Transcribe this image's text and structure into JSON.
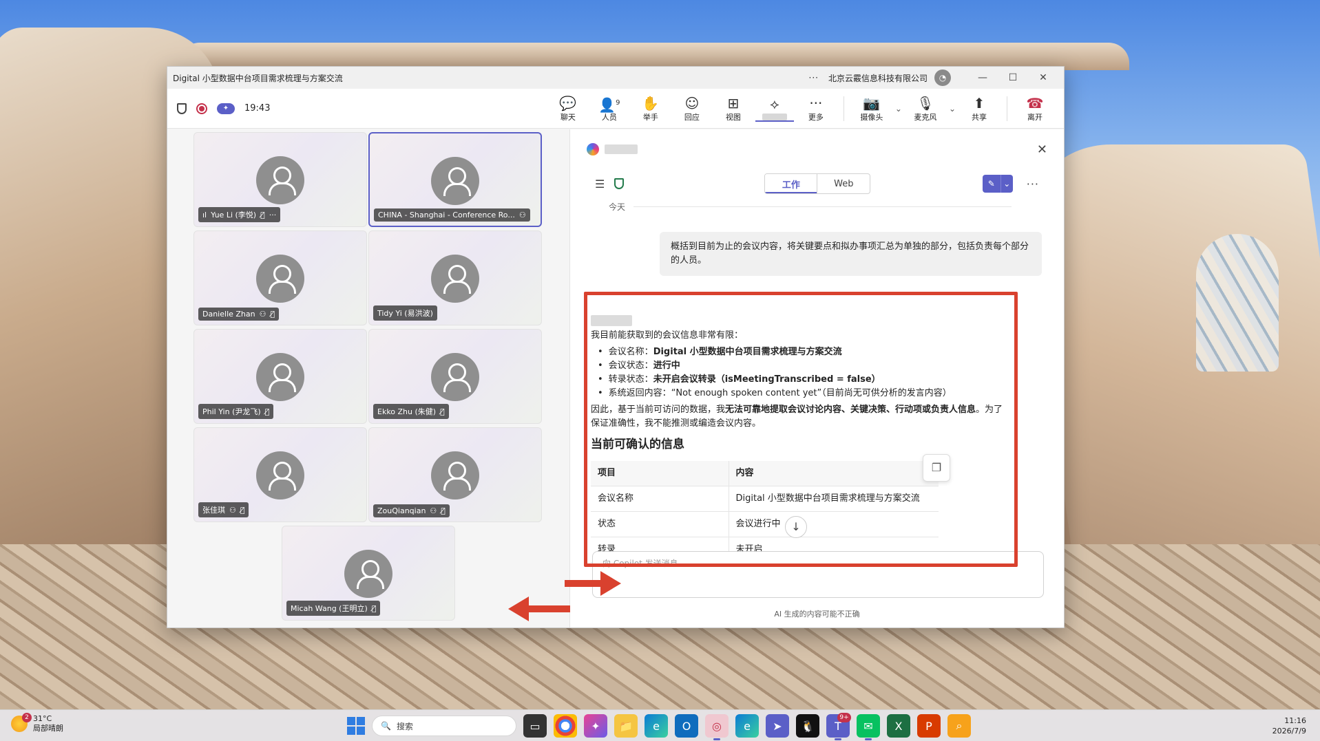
{
  "window": {
    "title": "Digital 小型数据中台项目需求梳理与方案交流",
    "more": "···",
    "org": "北京云霰信息科技有限公司",
    "controls": [
      "—",
      "☐",
      "✕"
    ]
  },
  "meeting": {
    "timer": "19:43",
    "ai_badge": "✦"
  },
  "toolbar": {
    "chat": "聊天",
    "people": "人员",
    "people_count": "9",
    "raise_hand": "举手",
    "react": "回应",
    "view": "视图",
    "more": "更多",
    "camera": "摄像头",
    "mic": "麦克风",
    "share": "共享",
    "leave": "离开"
  },
  "participants": [
    {
      "name": "Yue Li (李悦)",
      "extra": "···"
    },
    {
      "name": "CHINA - Shanghai - Conference Ro..."
    },
    {
      "name": "Danielle Zhan"
    },
    {
      "name": "Tidy Yi (易洪波)"
    },
    {
      "name": "Phil Yin (尹龙飞)"
    },
    {
      "name": "Ekko Zhu (朱健)"
    },
    {
      "name": "张佳琪"
    },
    {
      "name": "ZouQianqian"
    },
    {
      "name": "Micah Wang (王明立)"
    }
  ],
  "copilot": {
    "tabs": [
      "工作",
      "Web"
    ],
    "today": "今天",
    "user_prompt": "概括到目前为止的会议内容，将关键要点和拟办事项汇总为单独的部分，包括负责每个部分的人员。",
    "answer": {
      "intro": "我目前能获取到的会议信息非常有限：",
      "bullets": [
        {
          "label": "会议名称：",
          "value": "Digital 小型数据中台项目需求梳理与方案交流"
        },
        {
          "label": "会议状态：",
          "value": "进行中"
        },
        {
          "label": "转录状态：",
          "value": "未开启会议转录（isMeetingTranscribed = false）"
        },
        {
          "label": "系统返回内容：",
          "value": "“Not enough spoken content yet”（目前尚无可供分析的发言内容）"
        }
      ],
      "para_a": "因此，基于当前可访问的数据，我",
      "para_bold": "无法可靠地提取会议讨论内容、关键决策、行动项或负责人信息",
      "para_b": "。为了保证准确性，我不能推测或编造会议内容。",
      "heading": "当前可确认的信息",
      "table_headers": [
        "项目",
        "内容"
      ],
      "table_rows": [
        [
          "会议名称",
          "Digital 小型数据中台项目需求梳理与方案交流"
        ],
        [
          "状态",
          "会议进行中"
        ],
        [
          "转录",
          "未开启"
        ]
      ]
    },
    "compose_placeholder": "向 Copilot 发送消息",
    "disclaimer": "AI 生成的内容可能不正确"
  },
  "taskbar": {
    "weather_temp": "31°C",
    "weather_desc": "局部晴朗",
    "weather_badge": "2",
    "search": "搜索",
    "teams_badge": "9+",
    "time": "11:16",
    "date": "2026/7/9"
  },
  "colors": {
    "accent": "#5b5fc7",
    "annotation_red": "#d9412e",
    "leave_red": "#c4314b"
  }
}
